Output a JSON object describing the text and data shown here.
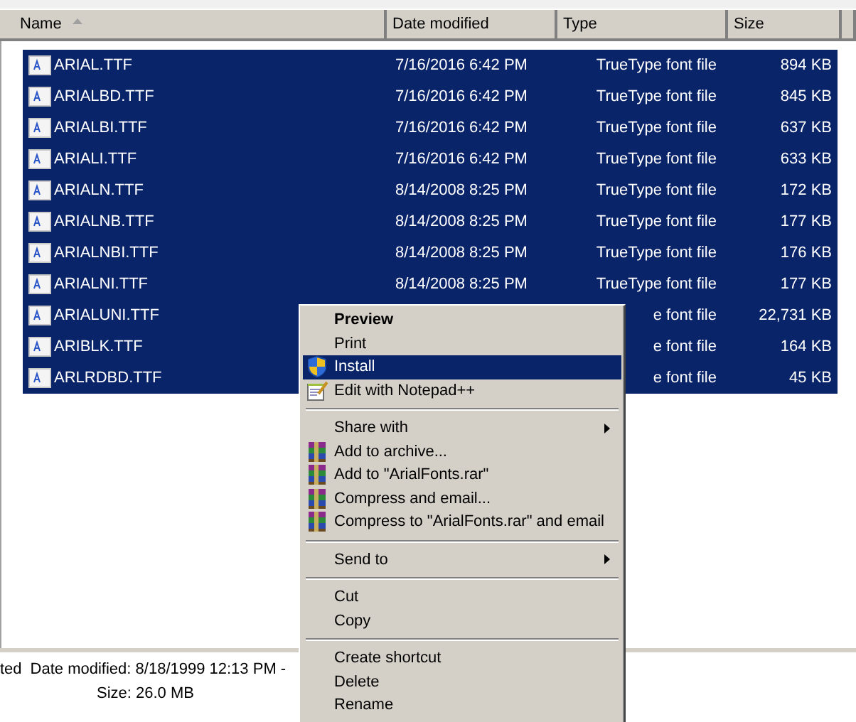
{
  "columns": [
    {
      "label": "Name",
      "sorted": true
    },
    {
      "label": "Date modified",
      "sorted": false
    },
    {
      "label": "Type",
      "sorted": false
    },
    {
      "label": "Size",
      "sorted": false
    }
  ],
  "files": [
    {
      "name": "ARIAL.TTF",
      "date": "7/16/2016 6:42 PM",
      "type": "TrueType font file",
      "size": "894 KB",
      "selected": true
    },
    {
      "name": "ARIALBD.TTF",
      "date": "7/16/2016 6:42 PM",
      "type": "TrueType font file",
      "size": "845 KB",
      "selected": true
    },
    {
      "name": "ARIALBI.TTF",
      "date": "7/16/2016 6:42 PM",
      "type": "TrueType font file",
      "size": "637 KB",
      "selected": true
    },
    {
      "name": "ARIALI.TTF",
      "date": "7/16/2016 6:42 PM",
      "type": "TrueType font file",
      "size": "633 KB",
      "selected": true
    },
    {
      "name": "ARIALN.TTF",
      "date": "8/14/2008 8:25 PM",
      "type": "TrueType font file",
      "size": "172 KB",
      "selected": true
    },
    {
      "name": "ARIALNB.TTF",
      "date": "8/14/2008 8:25 PM",
      "type": "TrueType font file",
      "size": "177 KB",
      "selected": true
    },
    {
      "name": "ARIALNBI.TTF",
      "date": "8/14/2008 8:25 PM",
      "type": "TrueType font file",
      "size": "176 KB",
      "selected": true
    },
    {
      "name": "ARIALNI.TTF",
      "date": "8/14/2008 8:25 PM",
      "type": "TrueType font file",
      "size": "177 KB",
      "selected": true
    },
    {
      "name": "ARIALUNI.TTF",
      "type": "e font file",
      "size": "22,731 KB",
      "selected": true
    },
    {
      "name": "ARIBLK.TTF",
      "type": "e font file",
      "size": "164 KB",
      "selected": true
    },
    {
      "name": "ARLRDBD.TTF",
      "type": "e font file",
      "size": "45 KB",
      "selected": true
    }
  ],
  "details": {
    "status": "ted",
    "date_modified": "Date modified: 8/18/1999 12:13 PM -",
    "size": "Size: 26.0 MB"
  },
  "context_menu": [
    {
      "kind": "plain",
      "label": "Preview",
      "default": true,
      "selected": false,
      "submenu": false
    },
    {
      "kind": "plain",
      "label": "Print",
      "default": false,
      "selected": false,
      "submenu": false
    },
    {
      "kind": "shield",
      "label": "Install",
      "default": false,
      "selected": true,
      "submenu": false
    },
    {
      "kind": "notepad",
      "label": "Edit with Notepad++",
      "default": false,
      "selected": false,
      "submenu": false
    },
    {
      "kind": "separator"
    },
    {
      "kind": "plain",
      "label": "Share with",
      "default": false,
      "selected": false,
      "submenu": true
    },
    {
      "kind": "archive",
      "label": "Add to archive...",
      "default": false,
      "selected": false,
      "submenu": false
    },
    {
      "kind": "archive",
      "label": "Add to \"ArialFonts.rar\"",
      "default": false,
      "selected": false,
      "submenu": false
    },
    {
      "kind": "archive",
      "label": "Compress and email...",
      "default": false,
      "selected": false,
      "submenu": false
    },
    {
      "kind": "archive",
      "label": "Compress to \"ArialFonts.rar\" and email",
      "default": false,
      "selected": false,
      "submenu": false
    },
    {
      "kind": "separator"
    },
    {
      "kind": "plain",
      "label": "Send to",
      "default": false,
      "selected": false,
      "submenu": true
    },
    {
      "kind": "separator"
    },
    {
      "kind": "plain",
      "label": "Cut",
      "default": false,
      "selected": false,
      "submenu": false
    },
    {
      "kind": "plain",
      "label": "Copy",
      "default": false,
      "selected": false,
      "submenu": false
    },
    {
      "kind": "separator"
    },
    {
      "kind": "plain",
      "label": "Create shortcut",
      "default": false,
      "selected": false,
      "submenu": false
    },
    {
      "kind": "plain",
      "label": "Delete",
      "default": false,
      "selected": false,
      "submenu": false
    },
    {
      "kind": "plain",
      "label": "Rename",
      "default": false,
      "selected": false,
      "submenu": false
    }
  ]
}
